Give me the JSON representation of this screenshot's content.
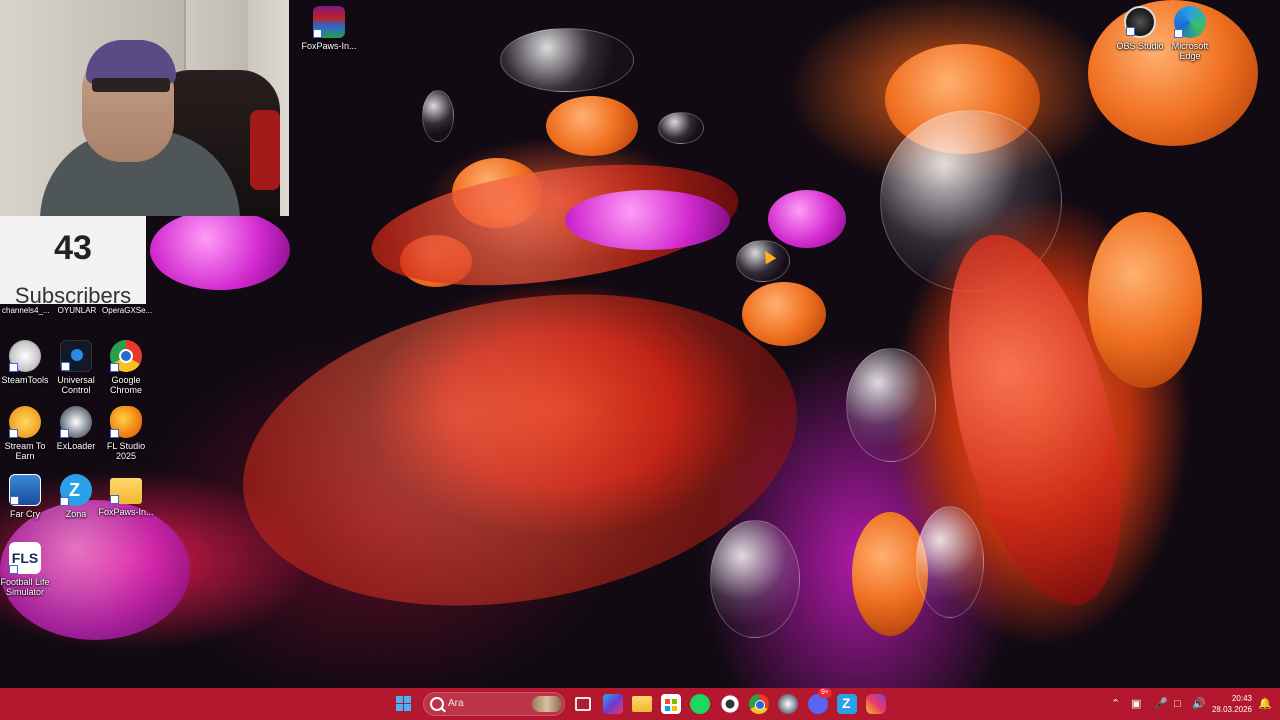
{
  "desktop": {
    "icons_top": [
      {
        "name": "foxpaws-installer-icon",
        "label": "FoxPaws-In..."
      }
    ],
    "icons_right": [
      {
        "name": "obs-studio-icon",
        "label": "OBS Studio"
      },
      {
        "name": "microsoft-edge-icon",
        "label": "Microsoft Edge"
      }
    ],
    "icons_left_top_labels": [
      "channels4_...",
      "OYUNLAR",
      "OperaGXSe..."
    ],
    "icons_left": [
      {
        "name": "steam-tools-icon",
        "label": "SteamTools"
      },
      {
        "name": "universal-control-icon",
        "label": "Universal Control"
      },
      {
        "name": "google-chrome-icon",
        "label": "Google Chrome"
      },
      {
        "name": "stream-to-earn-icon",
        "label": "Stream To Earn"
      },
      {
        "name": "exloader-icon",
        "label": "ExLoader"
      },
      {
        "name": "fl-studio-icon",
        "label": "FL Studio 2025"
      },
      {
        "name": "far-cry-icon",
        "label": "Far Cry"
      },
      {
        "name": "zona-icon",
        "label": "Zona"
      },
      {
        "name": "foxpaws-folder-icon",
        "label": "FoxPaws-In..."
      },
      {
        "name": "football-life-simulator-icon",
        "label": "Football Life Simulator"
      }
    ]
  },
  "subscriber_widget": {
    "count": "43",
    "label": "Subscribers"
  },
  "taskbar": {
    "search_placeholder": "Ara",
    "clock_time": "20:43",
    "clock_date": "28.03.2026",
    "discord_badge": "9+"
  },
  "colors": {
    "taskbar": "#b3182e",
    "accent": "#f07020"
  }
}
